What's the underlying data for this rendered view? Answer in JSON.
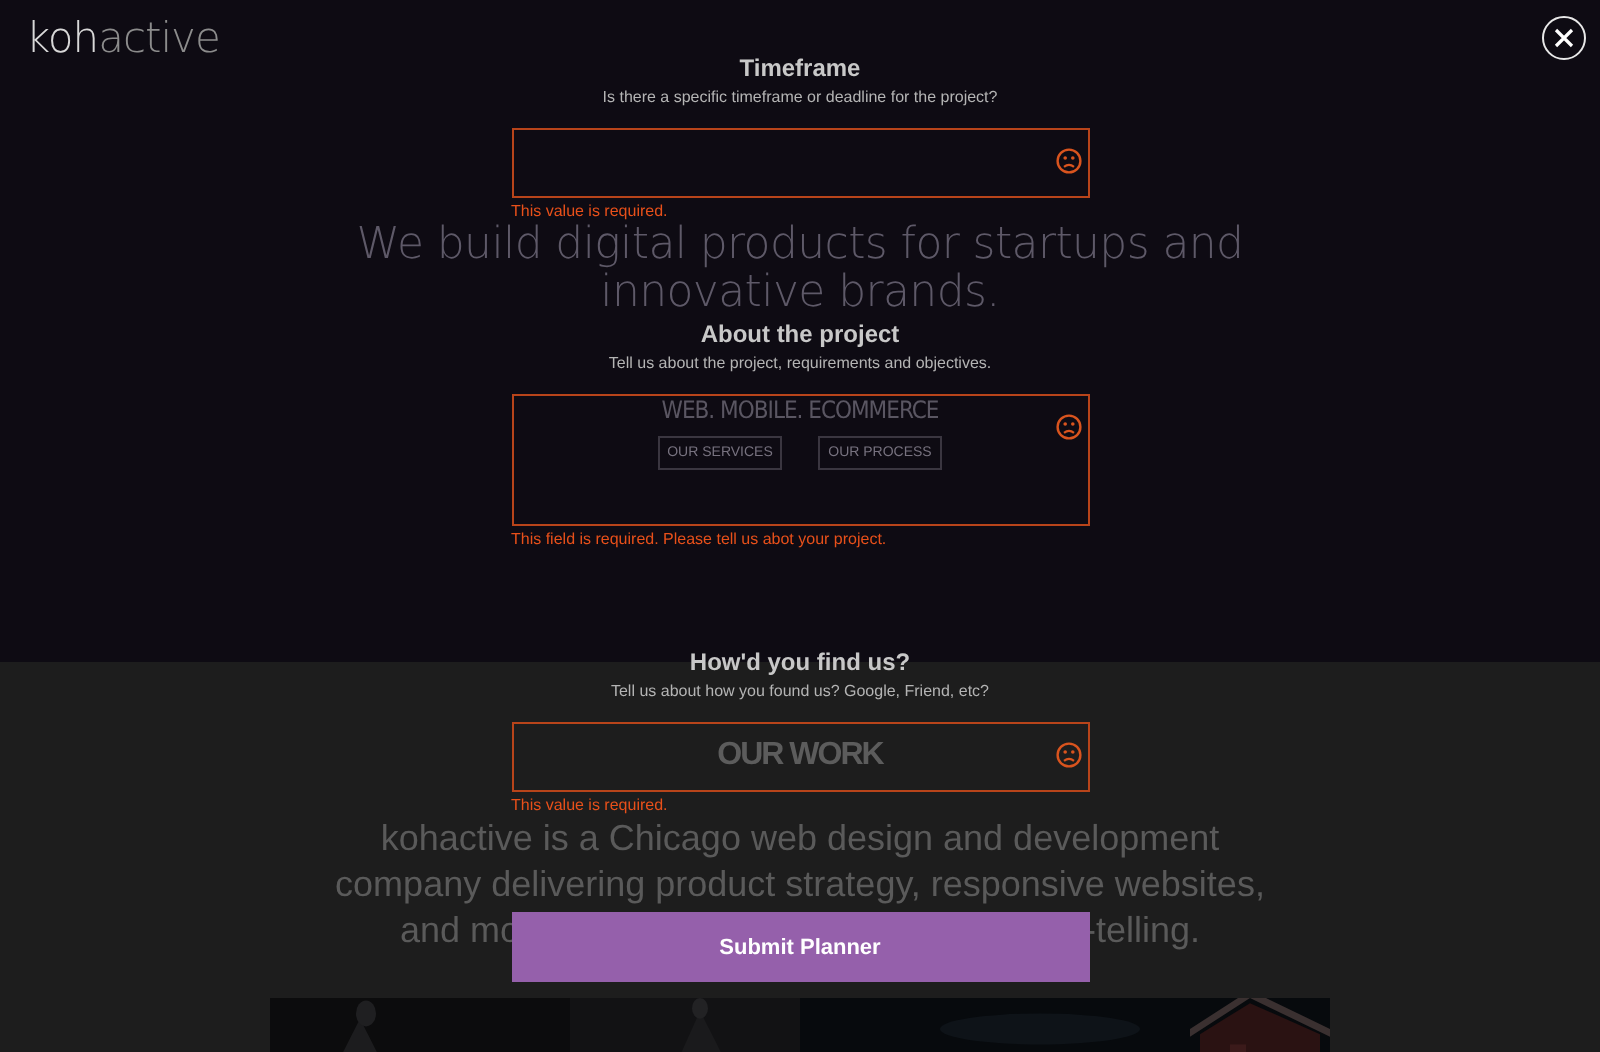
{
  "logo": {
    "part_a": "koh",
    "part_b": "active"
  },
  "background_page": {
    "headline": "We build digital products for startups and innovative brands.",
    "tagline": "WEB. MOBILE. ECOMMERCE",
    "buttons": [
      "OUR SERVICES",
      "OUR PROCESS"
    ],
    "section_title": "OUR WORK",
    "paragraph_lines": [
      "kohactive is a Chicago web design and development",
      "company delivering product strategy, responsive websites,"
    ],
    "paragraph_fragments": [
      "and mo",
      "-telling."
    ]
  },
  "form": {
    "fields": [
      {
        "kind": "input",
        "label": "Timeframe",
        "hint": "Is there a specific timeframe or deadline for the project?",
        "invalid": true,
        "error": "This value is required."
      },
      {
        "kind": "textarea",
        "label": "About the project",
        "hint": "Tell us about the project, requirements and objectives.",
        "invalid": true,
        "error": "This field is required. Please tell us abot your project."
      },
      {
        "kind": "input",
        "label": "How'd you find us?",
        "hint": "Tell us about how you found us? Google, Friend, etc?",
        "invalid": true,
        "error": "This value is required."
      }
    ],
    "submit": "Submit Planner"
  }
}
